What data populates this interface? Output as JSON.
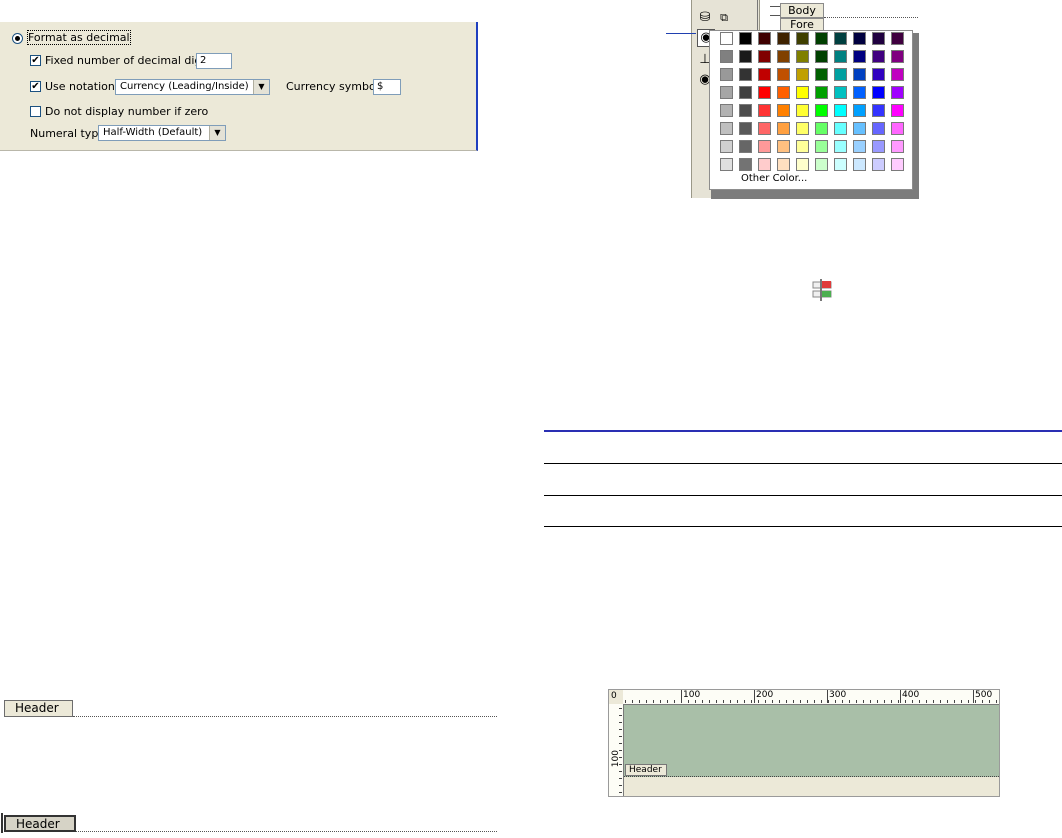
{
  "format_panel": {
    "format_decimal_label": "Format as decimal",
    "fixed_digits_label": "Fixed number of decimal digits:",
    "fixed_digits_value": "2",
    "use_notation_label": "Use notation:",
    "notation_value": "Currency (Leading/Inside)",
    "currency_symbol_label": "Currency symbol:",
    "currency_symbol_value": "$",
    "no_zero_label": "Do not display number if zero",
    "numeral_type_label": "Numeral type:",
    "numeral_type_value": "Half-Width (Default)",
    "checkmark": "✔"
  },
  "color_palette": {
    "body_tab": "Body",
    "fore_tab": "Fore",
    "other_color_label": "Other Color...",
    "rows": [
      [
        "#ffffff",
        "#000000",
        "#3f0000",
        "#3f2200",
        "#3f3f00",
        "#003f00",
        "#003f3f",
        "#00003f",
        "#1f003f",
        "#3f003f"
      ],
      [
        "#808080",
        "#1a1a1a",
        "#800000",
        "#804000",
        "#808000",
        "#004000",
        "#008080",
        "#000080",
        "#400080",
        "#800080"
      ],
      [
        "#999999",
        "#333333",
        "#c00000",
        "#c05000",
        "#c0a000",
        "#006000",
        "#00a0a0",
        "#0040c0",
        "#3000c0",
        "#c000c0"
      ],
      [
        "#a6a6a6",
        "#404040",
        "#ff0000",
        "#ff6000",
        "#ffff00",
        "#00a000",
        "#00c0c0",
        "#0060ff",
        "#0000ff",
        "#a000ff"
      ],
      [
        "#b3b3b3",
        "#4d4d4d",
        "#ff3333",
        "#ff8000",
        "#ffff33",
        "#00ff00",
        "#00ffff",
        "#00a0ff",
        "#3333ff",
        "#ff00ff"
      ],
      [
        "#c0c0c0",
        "#595959",
        "#ff6666",
        "#ffa040",
        "#ffff66",
        "#66ff66",
        "#66ffff",
        "#66c0ff",
        "#6666ff",
        "#ff66ff"
      ],
      [
        "#d0d0d0",
        "#666666",
        "#ff9999",
        "#ffc080",
        "#ffff99",
        "#99ff99",
        "#99ffff",
        "#99d0ff",
        "#9999ff",
        "#ff99ff"
      ],
      [
        "#e0e0e0",
        "#737373",
        "#ffcccc",
        "#ffe0c0",
        "#ffffcc",
        "#ccffcc",
        "#ccffff",
        "#cce8ff",
        "#ccccff",
        "#ffccff"
      ]
    ]
  },
  "header_bands": {
    "header_label_1": "Header",
    "header_label_2": "Header"
  },
  "ruler_view": {
    "tick_labels": [
      "100",
      "200",
      "300",
      "400",
      "500"
    ],
    "left_label": "100",
    "corner_label": "0",
    "header_tag": "Header"
  }
}
